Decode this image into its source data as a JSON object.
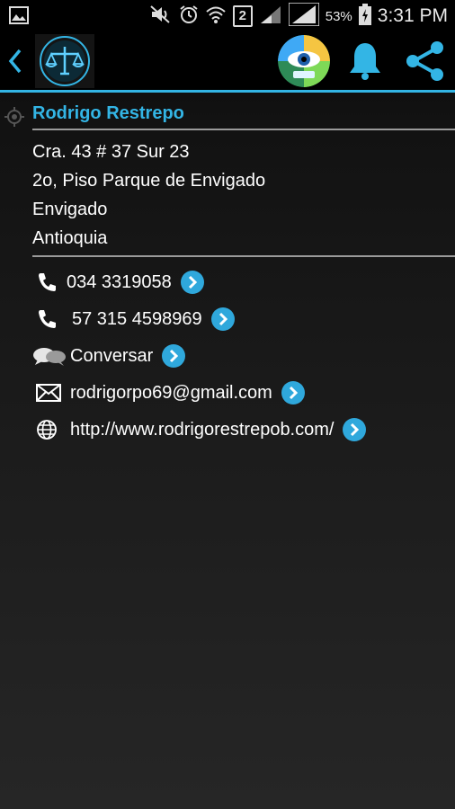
{
  "status_bar": {
    "battery_percent": "53%",
    "time": "3:31 PM",
    "sim_slot": "2",
    "icons": [
      "gallery-icon",
      "mute-icon",
      "alarm-icon",
      "wifi-icon",
      "sim-icon",
      "signal-icon",
      "signal-icon",
      "battery-charging-icon"
    ]
  },
  "app_bar": {
    "icons": [
      "back-icon",
      "scales-of-justice-logo",
      "profile-avatar",
      "bell-icon",
      "share-icon"
    ],
    "accent_color": "#33b5e5"
  },
  "contact": {
    "name": "Rodrigo Restrepo",
    "address": {
      "line1": "Cra. 43 # 37 Sur 23",
      "line2": "2o, Piso Parque de Envigado",
      "city": "Envigado",
      "region": "Antioquia"
    },
    "phone1": "034 3319058",
    "phone2": "57 315 4598969",
    "chat": "Conversar",
    "email": "rodrigorpo69@gmail.com",
    "website": "http://www.rodrigorestrepob.com/"
  }
}
